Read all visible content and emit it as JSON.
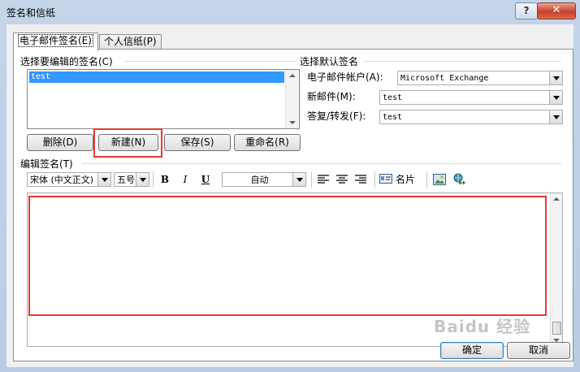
{
  "window": {
    "title": "签名和信纸"
  },
  "titlebar": {
    "help": "?",
    "close": "✕"
  },
  "tabs": [
    {
      "label": "电子邮件签名(E)"
    },
    {
      "label": "个人信纸(P)"
    }
  ],
  "select_signature": {
    "label": "选择要编辑的签名(C)",
    "items": [
      "test"
    ]
  },
  "buttons": {
    "delete": "删除(D)",
    "new": "新建(N)",
    "save": "保存(S)",
    "rename": "重命名(R)",
    "ok": "确定",
    "cancel": "取消"
  },
  "default_signature": {
    "label": "选择默认签名",
    "account_label": "电子邮件帐户(A):",
    "account_value": "Microsoft Exchange",
    "new_messages_label": "新邮件(M):",
    "new_messages_value": "test",
    "replies_label": "答复/转发(F):",
    "replies_value": "test"
  },
  "edit_signature": {
    "label": "编辑签名(T)",
    "font_value": "宋体 (中文正文)",
    "size_value": "五号",
    "bold": "B",
    "italic": "I",
    "underline": "U",
    "color_value": "自动",
    "business_card": "名片"
  },
  "watermark": "Baidu 经验"
}
